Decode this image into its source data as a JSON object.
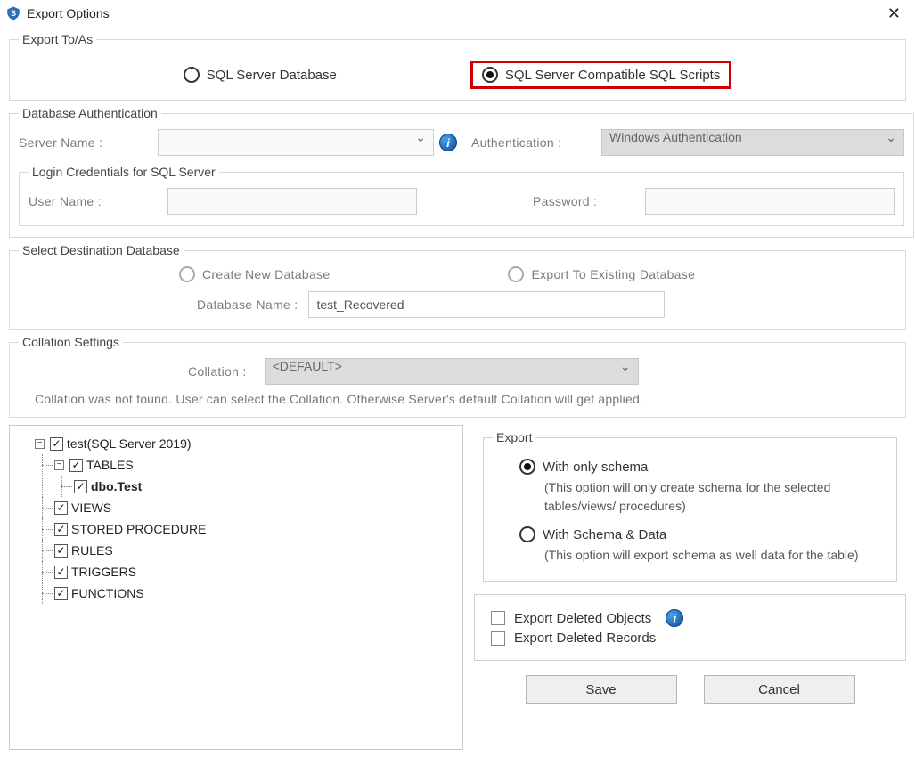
{
  "titlebar": {
    "title": "Export Options"
  },
  "exportTo": {
    "legend": "Export To/As",
    "opt1": "SQL Server Database",
    "opt2": "SQL Server Compatible SQL Scripts",
    "selected": "opt2"
  },
  "dbAuth": {
    "legend": "Database Authentication",
    "serverNameLabel": "Server Name :",
    "serverName": "",
    "authLabel": "Authentication :",
    "authValue": "Windows Authentication",
    "login": {
      "legend": "Login Credentials for SQL Server",
      "userLabel": "User Name :",
      "user": "",
      "passLabel": "Password :",
      "pass": ""
    }
  },
  "destDb": {
    "legend": "Select Destination Database",
    "createNew": "Create New Database",
    "exportExisting": "Export To Existing Database",
    "dbNameLabel": "Database Name :",
    "dbName": "test_Recovered"
  },
  "collation": {
    "legend": "Collation Settings",
    "label": "Collation :",
    "value": "<DEFAULT>",
    "msg": "Collation was not found. User can select the Collation. Otherwise Server's default Collation will get applied."
  },
  "tree": {
    "root": "test(SQL Server 2019)",
    "items": {
      "tables": "TABLES",
      "tableChild": "dbo.Test",
      "views": "VIEWS",
      "sp": "STORED PROCEDURE",
      "rules": "RULES",
      "triggers": "TRIGGERS",
      "functions": "FUNCTIONS"
    }
  },
  "export": {
    "legend": "Export",
    "opt1": "With only schema",
    "opt1desc": "(This option will only create schema for the  selected tables/views/ procedures)",
    "opt2": "With Schema & Data",
    "opt2desc": "(This option will export schema as well data for the table)",
    "deleted": {
      "objects": "Export Deleted Objects",
      "records": "Export Deleted Records"
    }
  },
  "buttons": {
    "save": "Save",
    "cancel": "Cancel"
  }
}
